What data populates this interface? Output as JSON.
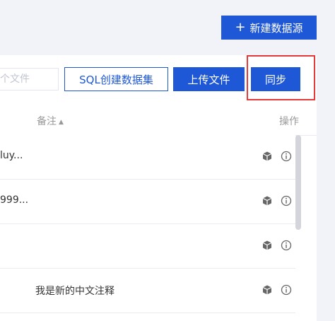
{
  "header": {
    "new_datasource_label": "新建数据源",
    "plus_icon": "+"
  },
  "toolbar": {
    "search_placeholder": "个文件",
    "sql_create_label": "SQL创建数据集",
    "upload_label": "上传文件",
    "sync_label": "同步"
  },
  "table": {
    "columns": {
      "remark": "备注",
      "remark_sort_icon": "sort-icon",
      "actions": "操作"
    },
    "rows": [
      {
        "name": "luy...",
        "remark": ""
      },
      {
        "name": "999...",
        "remark": ""
      },
      {
        "name": "",
        "remark": ""
      },
      {
        "name": "",
        "remark": "我是新的中文注释"
      }
    ]
  },
  "colors": {
    "primary": "#1f58d6",
    "highlight": "#e53a3a",
    "background": "#f1f3f8"
  }
}
